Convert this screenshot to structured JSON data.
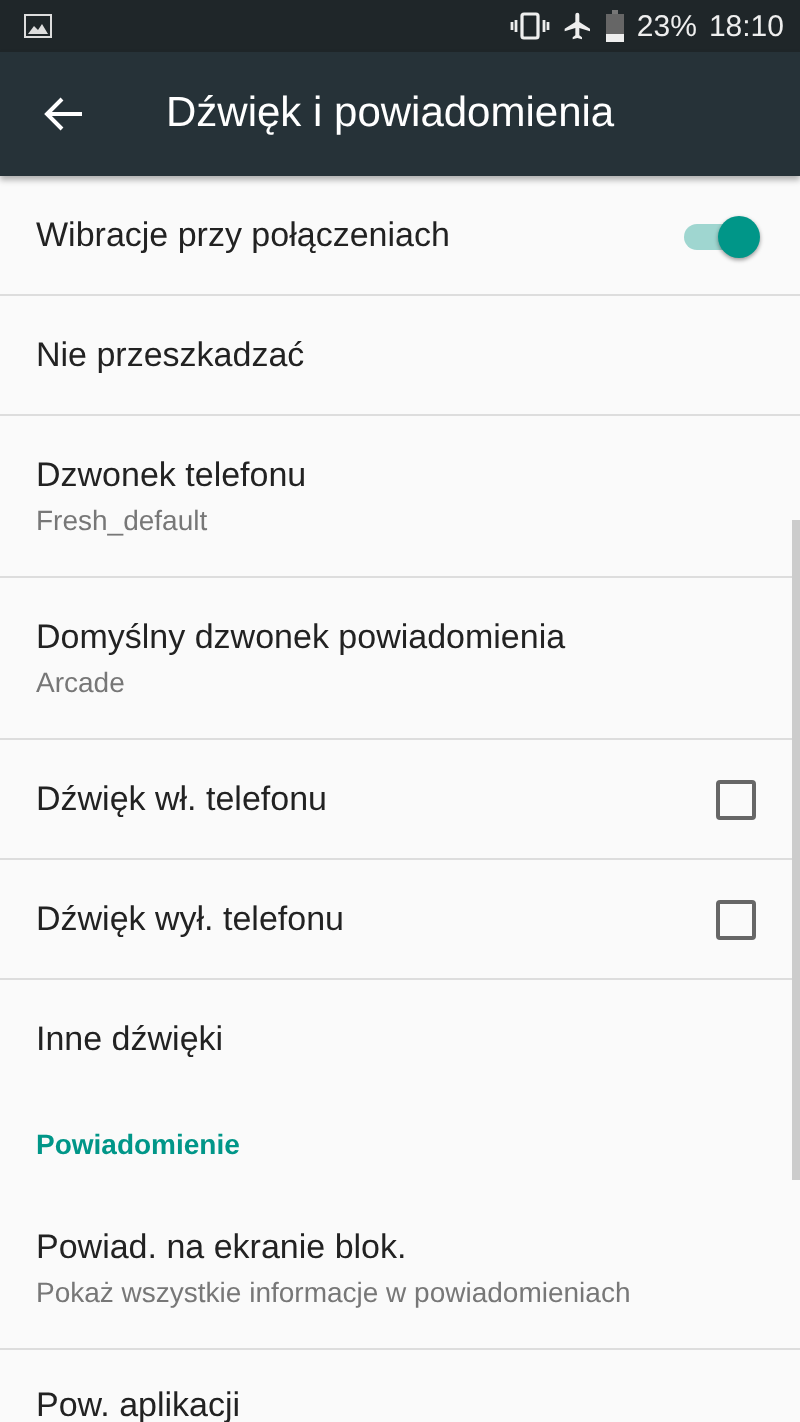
{
  "status_bar": {
    "battery": "23%",
    "time": "18:10"
  },
  "app_bar": {
    "title": "Dźwięk i powiadomienia"
  },
  "items": [
    {
      "kind": "switch",
      "title": "Wibracje przy połączeniach",
      "on": true
    },
    {
      "kind": "plain",
      "title": "Nie przeszkadzać"
    },
    {
      "kind": "plain",
      "title": "Dzwonek telefonu",
      "summary": "Fresh_default"
    },
    {
      "kind": "plain",
      "title": "Domyślny dzwonek powiadomienia",
      "summary": "Arcade"
    },
    {
      "kind": "checkbox",
      "title": "Dźwięk wł. telefonu",
      "checked": false
    },
    {
      "kind": "checkbox",
      "title": "Dźwięk wył. telefonu",
      "checked": false
    },
    {
      "kind": "plain",
      "title": "Inne dźwięki"
    },
    {
      "kind": "header",
      "title": "Powiadomienie"
    },
    {
      "kind": "plain",
      "title": "Powiad. na ekranie blok.",
      "summary": "Pokaż wszystkie informacje w powiadomieniach"
    },
    {
      "kind": "last",
      "title": "Pow. aplikacji"
    }
  ]
}
